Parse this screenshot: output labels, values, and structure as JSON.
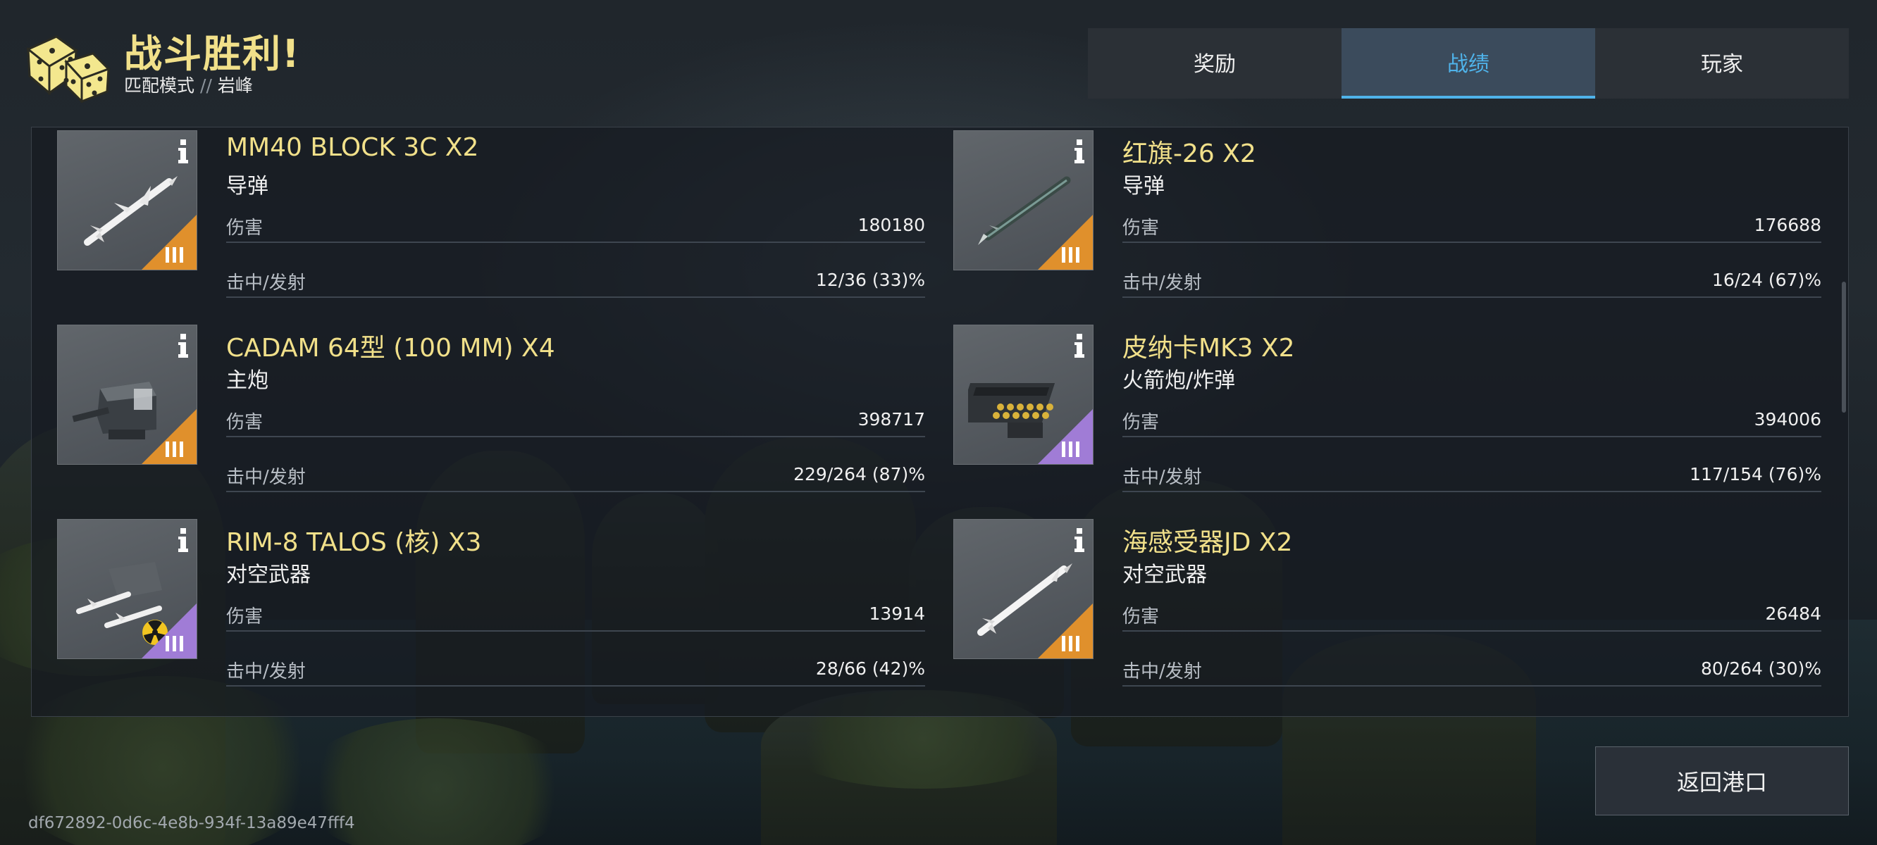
{
  "header": {
    "title": "战斗胜利!",
    "mode": "匹配模式",
    "separator": "//",
    "map": "岩峰"
  },
  "tabs": [
    {
      "label": "奖励",
      "active": false
    },
    {
      "label": "战绩",
      "active": true
    },
    {
      "label": "玩家",
      "active": false
    }
  ],
  "stat_labels": {
    "damage": "伤害",
    "hits": "击中/发射"
  },
  "weapons": [
    {
      "name": "MM40 BLOCK 3C X2",
      "type": "导弹",
      "damage": "180180",
      "hits": "12/36 (33)%",
      "rank": "III",
      "rank_color": "#e0902c",
      "icon": "anti-ship-missile-icon"
    },
    {
      "name": "红旗-26 X2",
      "type": "导弹",
      "damage": "176688",
      "hits": "16/24 (67)%",
      "rank": "III",
      "rank_color": "#e0902c",
      "icon": "sam-missile-icon"
    },
    {
      "name": "CADAM 64型 (100 MM) X4",
      "type": "主炮",
      "damage": "398717",
      "hits": "229/264 (87)%",
      "rank": "III",
      "rank_color": "#e0902c",
      "icon": "naval-gun-turret-icon"
    },
    {
      "name": "皮纳卡MK3 X2",
      "type": "火箭炮/炸弹",
      "damage": "394006",
      "hits": "117/154 (76)%",
      "rank": "III",
      "rank_color": "#a07cd6",
      "icon": "rocket-launcher-icon"
    },
    {
      "name": "RIM-8 TALOS (核) X3",
      "type": "对空武器",
      "damage": "13914",
      "hits": "28/66 (42)%",
      "rank": "III",
      "rank_color": "#a07cd6",
      "icon": "nuclear-missile-launcher-icon"
    },
    {
      "name": "海感受器JD X2",
      "type": "对空武器",
      "damage": "26484",
      "hits": "80/264 (30)%",
      "rank": "III",
      "rank_color": "#e0902c",
      "icon": "aa-missile-icon"
    }
  ],
  "footer": {
    "return_label": "返回港口",
    "match_id": "df672892-0d6c-4e8b-934f-13a89e47fff4"
  },
  "colors": {
    "accent_yellow": "#f1e08a",
    "tab_active": "#4fb3ea",
    "rank_orange": "#e0902c",
    "rank_purple": "#a07cd6"
  }
}
